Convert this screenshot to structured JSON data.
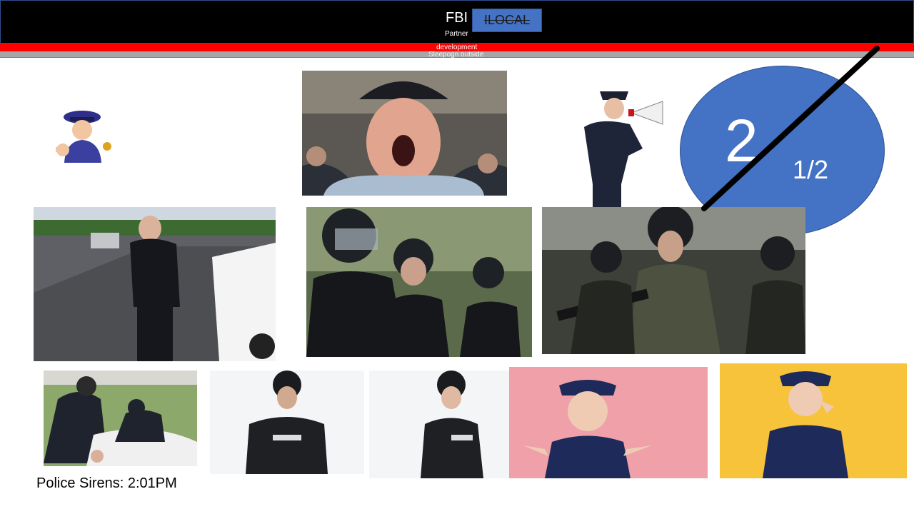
{
  "header": {
    "title": "FBI",
    "subtitle": "Partner",
    "badge_label": "ILOCAL"
  },
  "bars": {
    "red_label": "development",
    "grey_label": "Sleepogn outside"
  },
  "counter": {
    "number": "2",
    "fraction": "1/2"
  },
  "caption": "Police Sirens: 2:01PM",
  "photos": [
    {
      "name": "cartoon-police-officer-pointing"
    },
    {
      "name": "police-officer-shouting-closeup"
    },
    {
      "name": "police-officer-with-megaphone"
    },
    {
      "name": "police-officer-yelling-roadside"
    },
    {
      "name": "riot-police-yelling"
    },
    {
      "name": "riot-police-pointing-weapon"
    },
    {
      "name": "officers-arresting-person-on-grass"
    },
    {
      "name": "riot-officer-shouting-hands-at-mouth"
    },
    {
      "name": "female-riot-officer-shouting"
    },
    {
      "name": "female-officer-screaming-pink-background"
    },
    {
      "name": "female-officer-shouting-yellow-background"
    }
  ]
}
